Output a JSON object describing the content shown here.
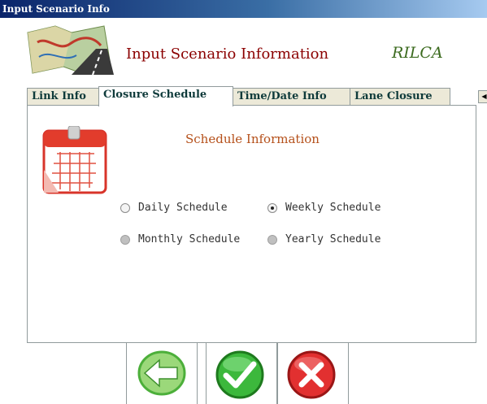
{
  "window": {
    "title": "Input Scenario Info"
  },
  "header": {
    "title": "Input Scenario Information",
    "brand": "RILCA"
  },
  "tabs": [
    {
      "label": "Link Info",
      "active": false
    },
    {
      "label": "Closure Schedule",
      "active": true
    },
    {
      "label": "Time/Date Info",
      "active": false
    },
    {
      "label": "Lane Closure",
      "active": false
    }
  ],
  "panel": {
    "title": "Schedule Information",
    "options": [
      {
        "label": "Daily Schedule",
        "selected": false,
        "enabled": true
      },
      {
        "label": "Weekly Schedule",
        "selected": true,
        "enabled": true
      },
      {
        "label": "Monthly Schedule",
        "selected": false,
        "enabled": false
      },
      {
        "label": "Yearly Schedule",
        "selected": false,
        "enabled": false
      }
    ]
  },
  "buttons": {
    "back": {
      "icon": "back-arrow-icon",
      "color": "#4caf3a"
    },
    "ok": {
      "icon": "checkmark-icon",
      "color": "#2e9e2e"
    },
    "cancel": {
      "icon": "close-icon",
      "color": "#d62222"
    }
  }
}
